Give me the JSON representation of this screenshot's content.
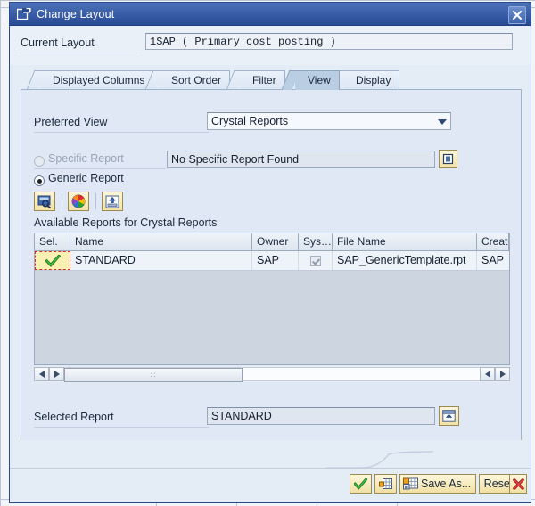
{
  "window": {
    "title": "Change Layout",
    "title_icon": "layout-window-icon",
    "close_label": "✖",
    "close_icon": "close-icon"
  },
  "current_layout": {
    "label": "Current Layout",
    "value": "1SAP ( Primary cost posting )"
  },
  "tabs": [
    {
      "label": "Displayed Columns",
      "active": false
    },
    {
      "label": "Sort Order",
      "active": false
    },
    {
      "label": "Filter",
      "active": false
    },
    {
      "label": "View",
      "active": true
    },
    {
      "label": "Display",
      "active": false
    }
  ],
  "view_tab": {
    "preferred_view": {
      "label": "Preferred View",
      "value": "Crystal Reports",
      "dropdown_icon": "chevron-down-icon"
    },
    "specific_report": {
      "label": "Specific Report",
      "value": "No Specific Report Found",
      "selected": false,
      "disabled": true,
      "picker_icon": "value-help-icon"
    },
    "generic_report": {
      "label": "Generic Report",
      "selected": true
    },
    "toolbar": [
      {
        "name": "display-report-icon",
        "tooltip": "Display Report"
      },
      {
        "name": "color-palette-icon",
        "tooltip": "Colors"
      },
      {
        "name": "import-report-icon",
        "tooltip": "Import"
      }
    ],
    "grid": {
      "title": "Available Reports for Crystal Reports",
      "columns": [
        "Sel.",
        "Name",
        "Owner",
        "Sys…",
        "File Name",
        "Created"
      ],
      "rows": [
        {
          "selected": true,
          "selected_icon": "check-icon",
          "name": "STANDARD",
          "owner": "SAP",
          "sys": true,
          "file_name": "SAP_GenericTemplate.rpt",
          "created": "SAP"
        }
      ],
      "scrollbar": {
        "left_icon": "arrow-left-icon",
        "right_icon": "arrow-right-icon",
        "grip_glyph": "∷"
      }
    },
    "selected_report": {
      "label": "Selected Report",
      "value": "STANDARD",
      "picker_icon": "select-report-icon"
    }
  },
  "footer": {
    "buttons": [
      {
        "name": "confirm-button",
        "label": "",
        "icon": "check-icon"
      },
      {
        "name": "copy-layout-button",
        "label": "",
        "icon": "grid-layout-icon"
      },
      {
        "name": "save-as-button",
        "label": "Save As...",
        "icon": "save-grid-icon"
      },
      {
        "name": "reset-button",
        "label": "Reset",
        "icon": ""
      },
      {
        "name": "cancel-button",
        "label": "",
        "icon": "cancel-x-icon"
      }
    ]
  },
  "colors": {
    "titlebar_from": "#4d72b8",
    "titlebar_to": "#284a94",
    "panel_bg": "#dfe8f4",
    "grid_empty_bg": "#ccd5e0",
    "selection_yellow": "#fbf0b4",
    "selection_border": "#d2302f",
    "button_gold": "#f1e0a4",
    "check_green": "#2f9e2f"
  }
}
